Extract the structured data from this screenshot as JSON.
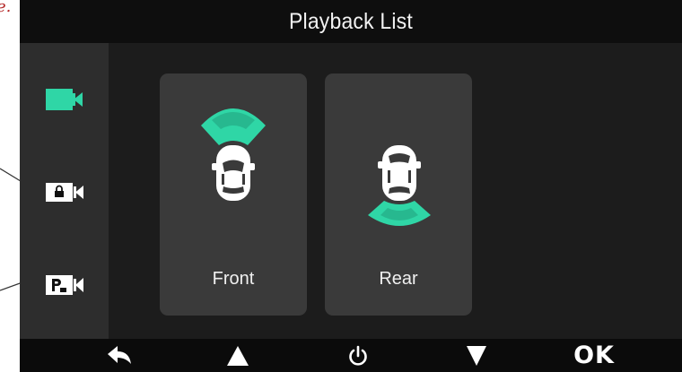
{
  "screen": {
    "title": "Playback List",
    "accent_color": "#2fd6a6",
    "background": "#1b1b1b"
  },
  "annotation": {
    "text": "e."
  },
  "sidebar": {
    "items": [
      {
        "icon": "video-camera-icon",
        "state": "selected"
      },
      {
        "icon": "locked-video-icon",
        "state": "normal"
      },
      {
        "icon": "parking-video-icon",
        "state": "normal"
      }
    ]
  },
  "cards": [
    {
      "label": "Front",
      "icon": "car-front-sensor-icon"
    },
    {
      "label": "Rear",
      "icon": "car-rear-sensor-icon"
    }
  ],
  "bottom_bar": {
    "buttons": [
      {
        "icon": "back-arrow-icon"
      },
      {
        "icon": "up-triangle-icon"
      },
      {
        "icon": "power-icon"
      },
      {
        "icon": "down-triangle-icon"
      },
      {
        "icon": "ok-icon",
        "label": "OK"
      }
    ]
  }
}
